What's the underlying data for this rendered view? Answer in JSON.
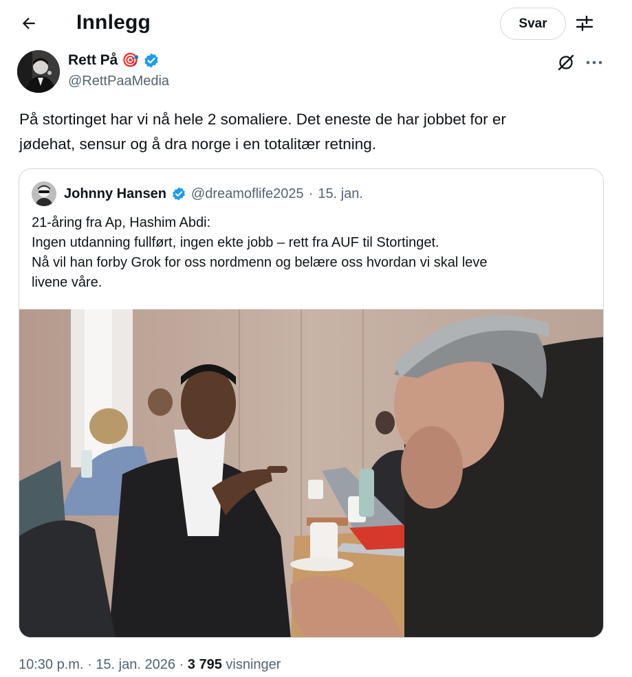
{
  "header": {
    "title": "Innlegg",
    "reply_label": "Svar",
    "icons": [
      "arrow-left-icon",
      "sliders-icon"
    ]
  },
  "post": {
    "author_name": "Rett På",
    "author_emoji": "🎯",
    "author_handle": "@RettPaaMedia",
    "verified": true,
    "text_lines": [
      "På stortinget har vi nå hele 2 somaliere.  Det eneste de har jobbet for er",
      "jødehat, sensur og å dra norge i en totalitær retning."
    ],
    "icons": [
      "grok-icon",
      "more-icon"
    ]
  },
  "quote": {
    "author_name": "Johnny Hansen",
    "verified": true,
    "author_handle": "@dreamoflife2025",
    "separator": "·",
    "date": "15. jan.",
    "text_lines": [
      "21-åring fra Ap, Hashim Abdi:",
      "Ingen utdanning fullført, ingen ekte jobb – rett fra AUF til Stortinget.",
      "Nå vil han forby Grok for oss nordmenn og belære oss hvordan vi skal leve",
      "livene våre."
    ]
  },
  "meta": {
    "time": "10:30 p.m.",
    "sep1": "·",
    "date": "15. jan. 2026",
    "sep2": "·",
    "views_count": "3 795",
    "views_label": "visninger"
  },
  "colors": {
    "text": "#0f1419",
    "secondary": "#536471",
    "verified": "#1d9bf0",
    "border": "#cfd9de"
  }
}
